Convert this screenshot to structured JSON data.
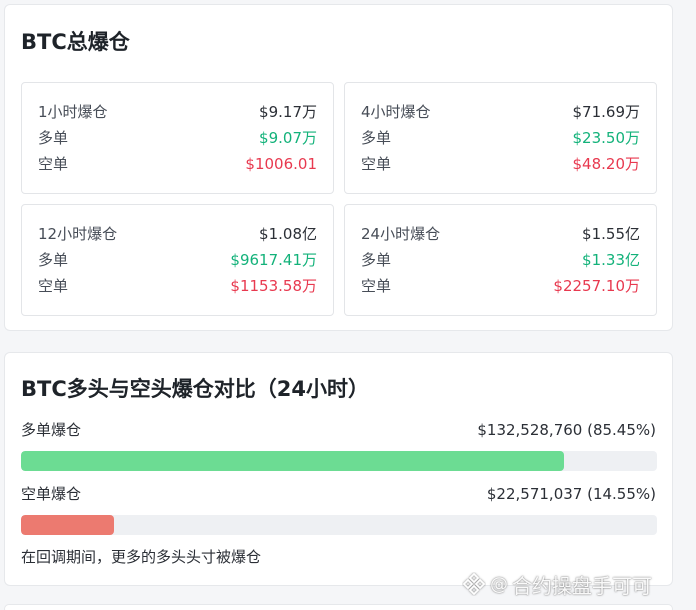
{
  "total": {
    "title": "BTC总爆仓",
    "long_label": "多单",
    "short_label": "空单",
    "periods": [
      {
        "label": "1小时爆仓",
        "total": "$9.17万",
        "long": "$9.07万",
        "short": "$1006.01"
      },
      {
        "label": "4小时爆仓",
        "total": "$71.69万",
        "long": "$23.50万",
        "short": "$48.20万"
      },
      {
        "label": "12小时爆仓",
        "total": "$1.08亿",
        "long": "$9617.41万",
        "short": "$1153.58万"
      },
      {
        "label": "24小时爆仓",
        "total": "$1.55亿",
        "long": "$1.33亿",
        "short": "$2257.10万"
      }
    ]
  },
  "compare": {
    "title": "BTC多头与空头爆仓对比（24小时）",
    "long": {
      "label": "多单爆仓",
      "value": "$132,528,760 (85.45%)",
      "percent": 85.45,
      "color": "#6cdc93"
    },
    "short": {
      "label": "空单爆仓",
      "value": "$22,571,037 (14.55%)",
      "percent": 14.55,
      "color": "#ec7a70"
    },
    "note": "在回调期间，更多的多头头寸被爆仓"
  },
  "colors": {
    "green": "#13b27a",
    "red": "#e8394f"
  },
  "watermark": {
    "text": "合约操盘手可可",
    "icon": "binance-square-logo-icon"
  }
}
